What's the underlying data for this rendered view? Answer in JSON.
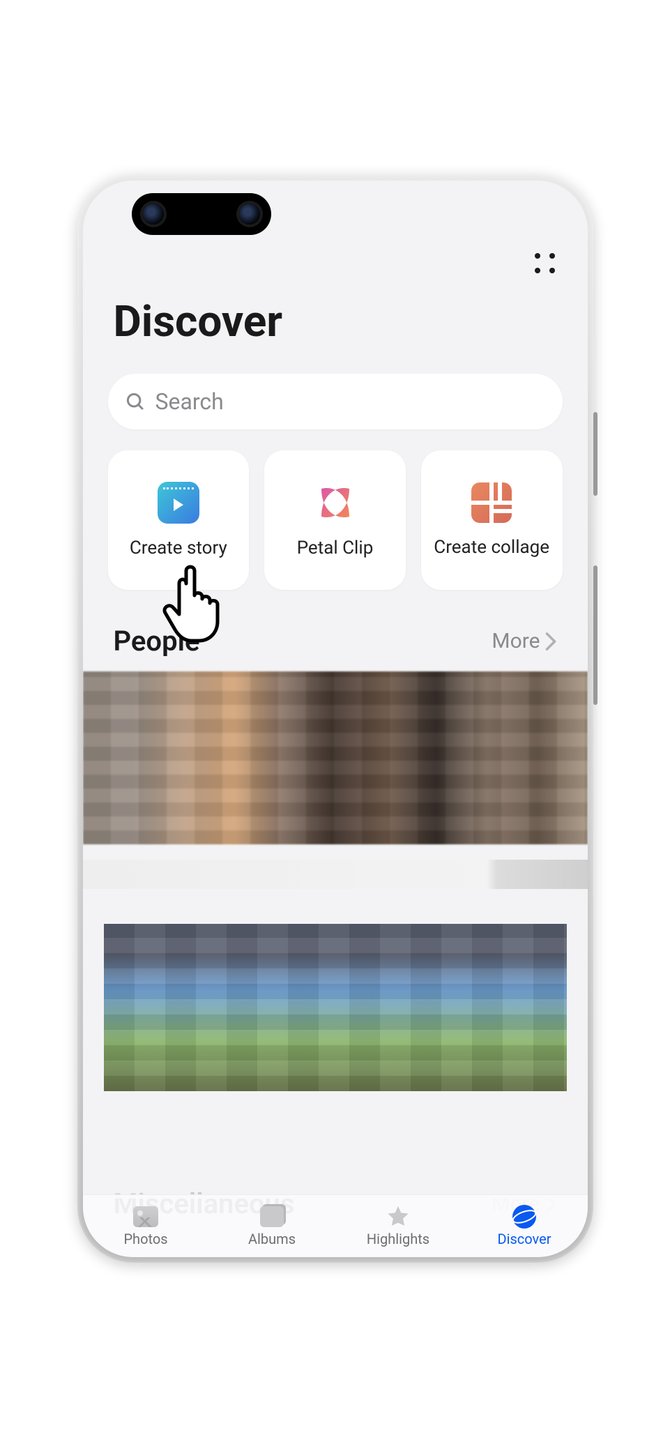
{
  "header": {
    "title": "Discover"
  },
  "search": {
    "placeholder": "Search"
  },
  "create_cards": [
    {
      "id": "create-story",
      "label": "Create story"
    },
    {
      "id": "petal-clip",
      "label": "Petal Clip"
    },
    {
      "id": "create-collage",
      "label": "Create collage"
    }
  ],
  "sections": {
    "people": {
      "title": "People",
      "more": "More"
    },
    "misc": {
      "title": "Miscellaneous",
      "more": "More"
    }
  },
  "navbar": [
    {
      "id": "photos",
      "label": "Photos",
      "active": false
    },
    {
      "id": "albums",
      "label": "Albums",
      "active": false
    },
    {
      "id": "highlights",
      "label": "Highlights",
      "active": false
    },
    {
      "id": "discover",
      "label": "Discover",
      "active": true
    }
  ]
}
